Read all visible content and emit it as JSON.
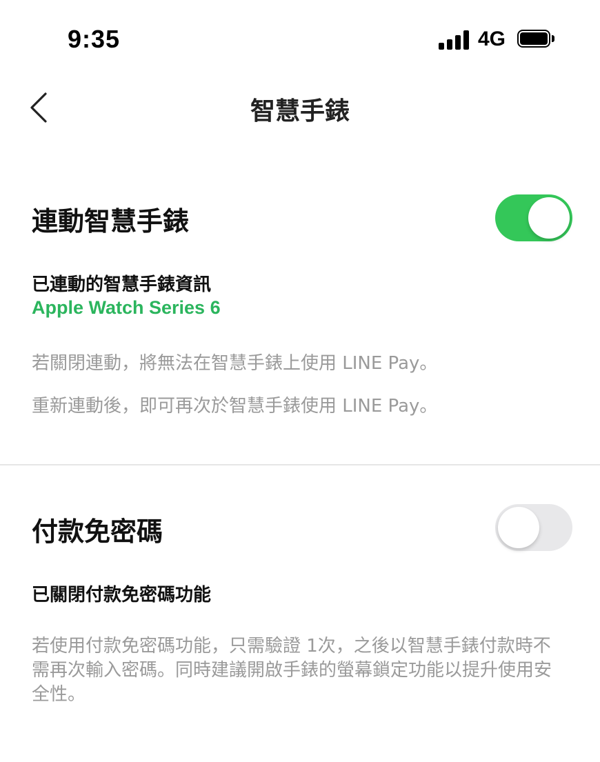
{
  "status_bar": {
    "time": "9:35",
    "network": "4G",
    "signal_icon": "cellular-signal-icon",
    "battery_icon": "battery-icon"
  },
  "nav": {
    "back_icon": "chevron-left-icon",
    "title": "智慧手錶"
  },
  "watch_link": {
    "heading": "連動智慧手錶",
    "toggle_on": true,
    "info_label": "已連動的智慧手錶資訊",
    "device_name": "Apple Watch Series 6",
    "note_1": "若關閉連動，將無法在智慧手錶上使用 LINE Pay。",
    "note_2": "重新連動後，即可再次於智慧手錶使用 LINE Pay。"
  },
  "passwordless": {
    "heading": "付款免密碼",
    "toggle_on": false,
    "status_label": "已關閉付款免密碼功能",
    "note": "若使用付款免密碼功能，只需驗證 1次，之後以智慧手錶付款時不需再次輸入密碼。同時建議開啟手錶的螢幕鎖定功能以提升使用安全性。"
  },
  "colors": {
    "accent_green": "#34c759",
    "device_text_green": "#2bb55d",
    "toggle_off": "#e8e8ea",
    "note_gray": "#9a9a9a"
  }
}
